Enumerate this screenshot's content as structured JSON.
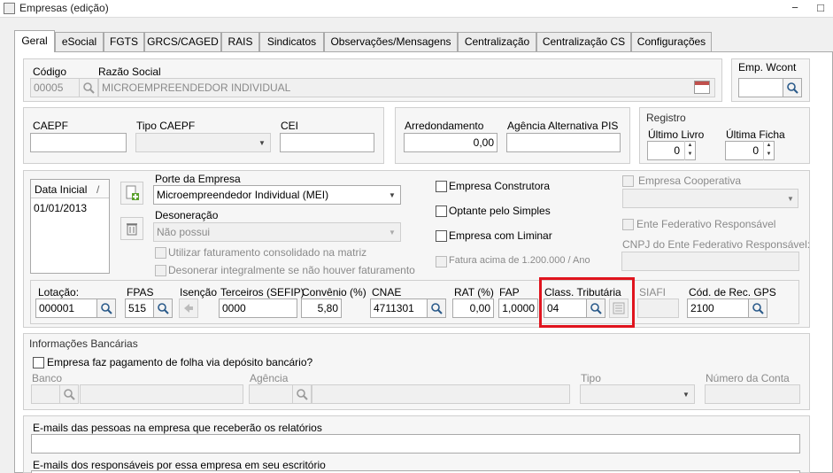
{
  "window": {
    "title": "Empresas (edição)",
    "minimize": "−",
    "maximize": "□"
  },
  "tabs": [
    "Geral",
    "eSocial",
    "FGTS",
    "GRCS/CAGED",
    "RAIS",
    "Sindicatos",
    "Observações/Mensagens",
    "Centralização",
    "Centralização CS",
    "Configurações"
  ],
  "empresa": {
    "codigo_label": "Código",
    "codigo_value": "00005",
    "razao_label": "Razão Social",
    "razao_value": "MICROEMPREENDEDOR INDIVIDUAL",
    "wcont_label": "Emp. Wcont",
    "wcont_value": ""
  },
  "caepf": {
    "caepf_label": "CAEPF",
    "caepf_value": "",
    "tipo_label": "Tipo CAEPF",
    "tipo_value": "",
    "cei_label": "CEI",
    "cei_value": ""
  },
  "arred": {
    "arred_label": "Arredondamento",
    "arred_value": "0,00",
    "agencia_pis_label": "Agência Alternativa PIS",
    "agencia_pis_value": ""
  },
  "registro": {
    "title": "Registro",
    "ultimo_livro_label": "Último Livro",
    "ultimo_livro_value": "0",
    "ultima_ficha_label": "Última Ficha",
    "ultima_ficha_value": "0"
  },
  "data_list": {
    "header": "Data Inicial",
    "sort": "/",
    "rows": [
      "01/01/2013"
    ]
  },
  "porte": {
    "porte_label": "Porte da Empresa",
    "porte_value": "Microempreendedor Individual (MEI)",
    "desoneracao_label": "Desoneração",
    "desoneracao_value": "Não possui",
    "fat_consolidado": "Utilizar faturamento consolidado na matriz",
    "desonerar_integral": "Desonerar integralmente se não houver faturamento"
  },
  "checks": {
    "construtora": "Empresa Construtora",
    "simples": "Optante pelo Simples",
    "liminar": "Empresa com Liminar",
    "fatura_acima": "Fatura acima de 1.200.000 / Ano",
    "cooperativa": "Empresa Cooperativa",
    "ente_federativo": "Ente Federativo Responsável",
    "cnpj_ente_label": "CNPJ do Ente Federativo Responsável:"
  },
  "lotacao": {
    "lotacao_label": "Lotação:",
    "lotacao_value": "000001",
    "fpas_label": "FPAS",
    "fpas_value": "515",
    "isencao_label": "Isenção",
    "terceiros_label": "Terceiros (SEFIP)",
    "terceiros_value": "0000",
    "convenio_label": "Convênio (%)",
    "convenio_value": "5,80",
    "cnae_label": "CNAE",
    "cnae_value": "4711301",
    "rat_label": "RAT (%)",
    "rat_value": "0,00",
    "fap_label": "FAP",
    "fap_value": "1,0000",
    "class_label": "Class. Tributária",
    "class_value": "04",
    "siafi_label": "SIAFI",
    "siafi_value": "",
    "codrec_label": "Cód. de Rec. GPS",
    "codrec_value": "2100"
  },
  "bancarias": {
    "title": "Informações Bancárias",
    "deposito": "Empresa faz pagamento de folha via depósito bancário?",
    "banco_label": "Banco",
    "agencia_label": "Agência",
    "tipo_label": "Tipo",
    "conta_label": "Número da Conta"
  },
  "emails": {
    "relatorios_label": "E-mails das pessoas na empresa que receberão os relatórios",
    "responsaveis_label": "E-mails dos responsáveis por essa empresa em seu escritório"
  },
  "colors": {
    "highlight": "#e0141e",
    "active_tab": "#ffffff"
  }
}
